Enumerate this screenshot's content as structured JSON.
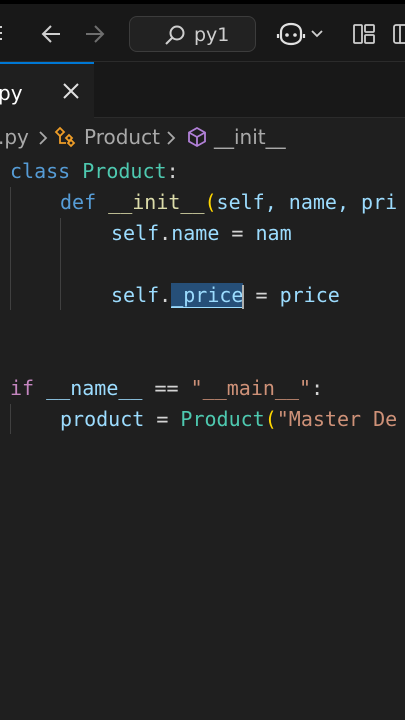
{
  "titlebar": {
    "search_label": "py1"
  },
  "tab": {
    "name": "py",
    "close": "✕"
  },
  "breadcrumb": {
    "file": ".py",
    "class": "Product",
    "method": "__init__"
  },
  "code": {
    "l1": {
      "kw": "class",
      "cls": "Product",
      "colon": ":"
    },
    "l2": {
      "kw": "def",
      "fn": "__init__",
      "paren": "(",
      "params": "self, name, pri"
    },
    "l3": {
      "self": "self",
      "dot": ".",
      "attr": "name",
      "eq": " = ",
      "val": "nam"
    },
    "l5": {
      "self": "self",
      "dot": ".",
      "attr": "_price",
      "eq": " = ",
      "val": "price"
    },
    "l7": {
      "kw": "if",
      "name": "__name__",
      "eq": " == ",
      "str": "\"__main__\"",
      "colon": ":"
    },
    "l8": {
      "var": "product",
      "eq": " = ",
      "cls": "Product",
      "paren": "(",
      "str": "\"Master De"
    }
  },
  "colors": {
    "accent": "#0078d4",
    "keyword": "#569cd6",
    "control": "#c586c0",
    "class": "#4ec9b0",
    "function": "#dcdcaa",
    "variable": "#9cdcfe",
    "string": "#ce9178"
  },
  "icons": [
    "menu-icon",
    "arrow-left-icon",
    "arrow-right-icon",
    "search-icon",
    "copilot-icon",
    "chevron-down-icon",
    "layout-icon",
    "close-icon",
    "chevron-right-icon",
    "class-icon",
    "method-cube-icon"
  ]
}
